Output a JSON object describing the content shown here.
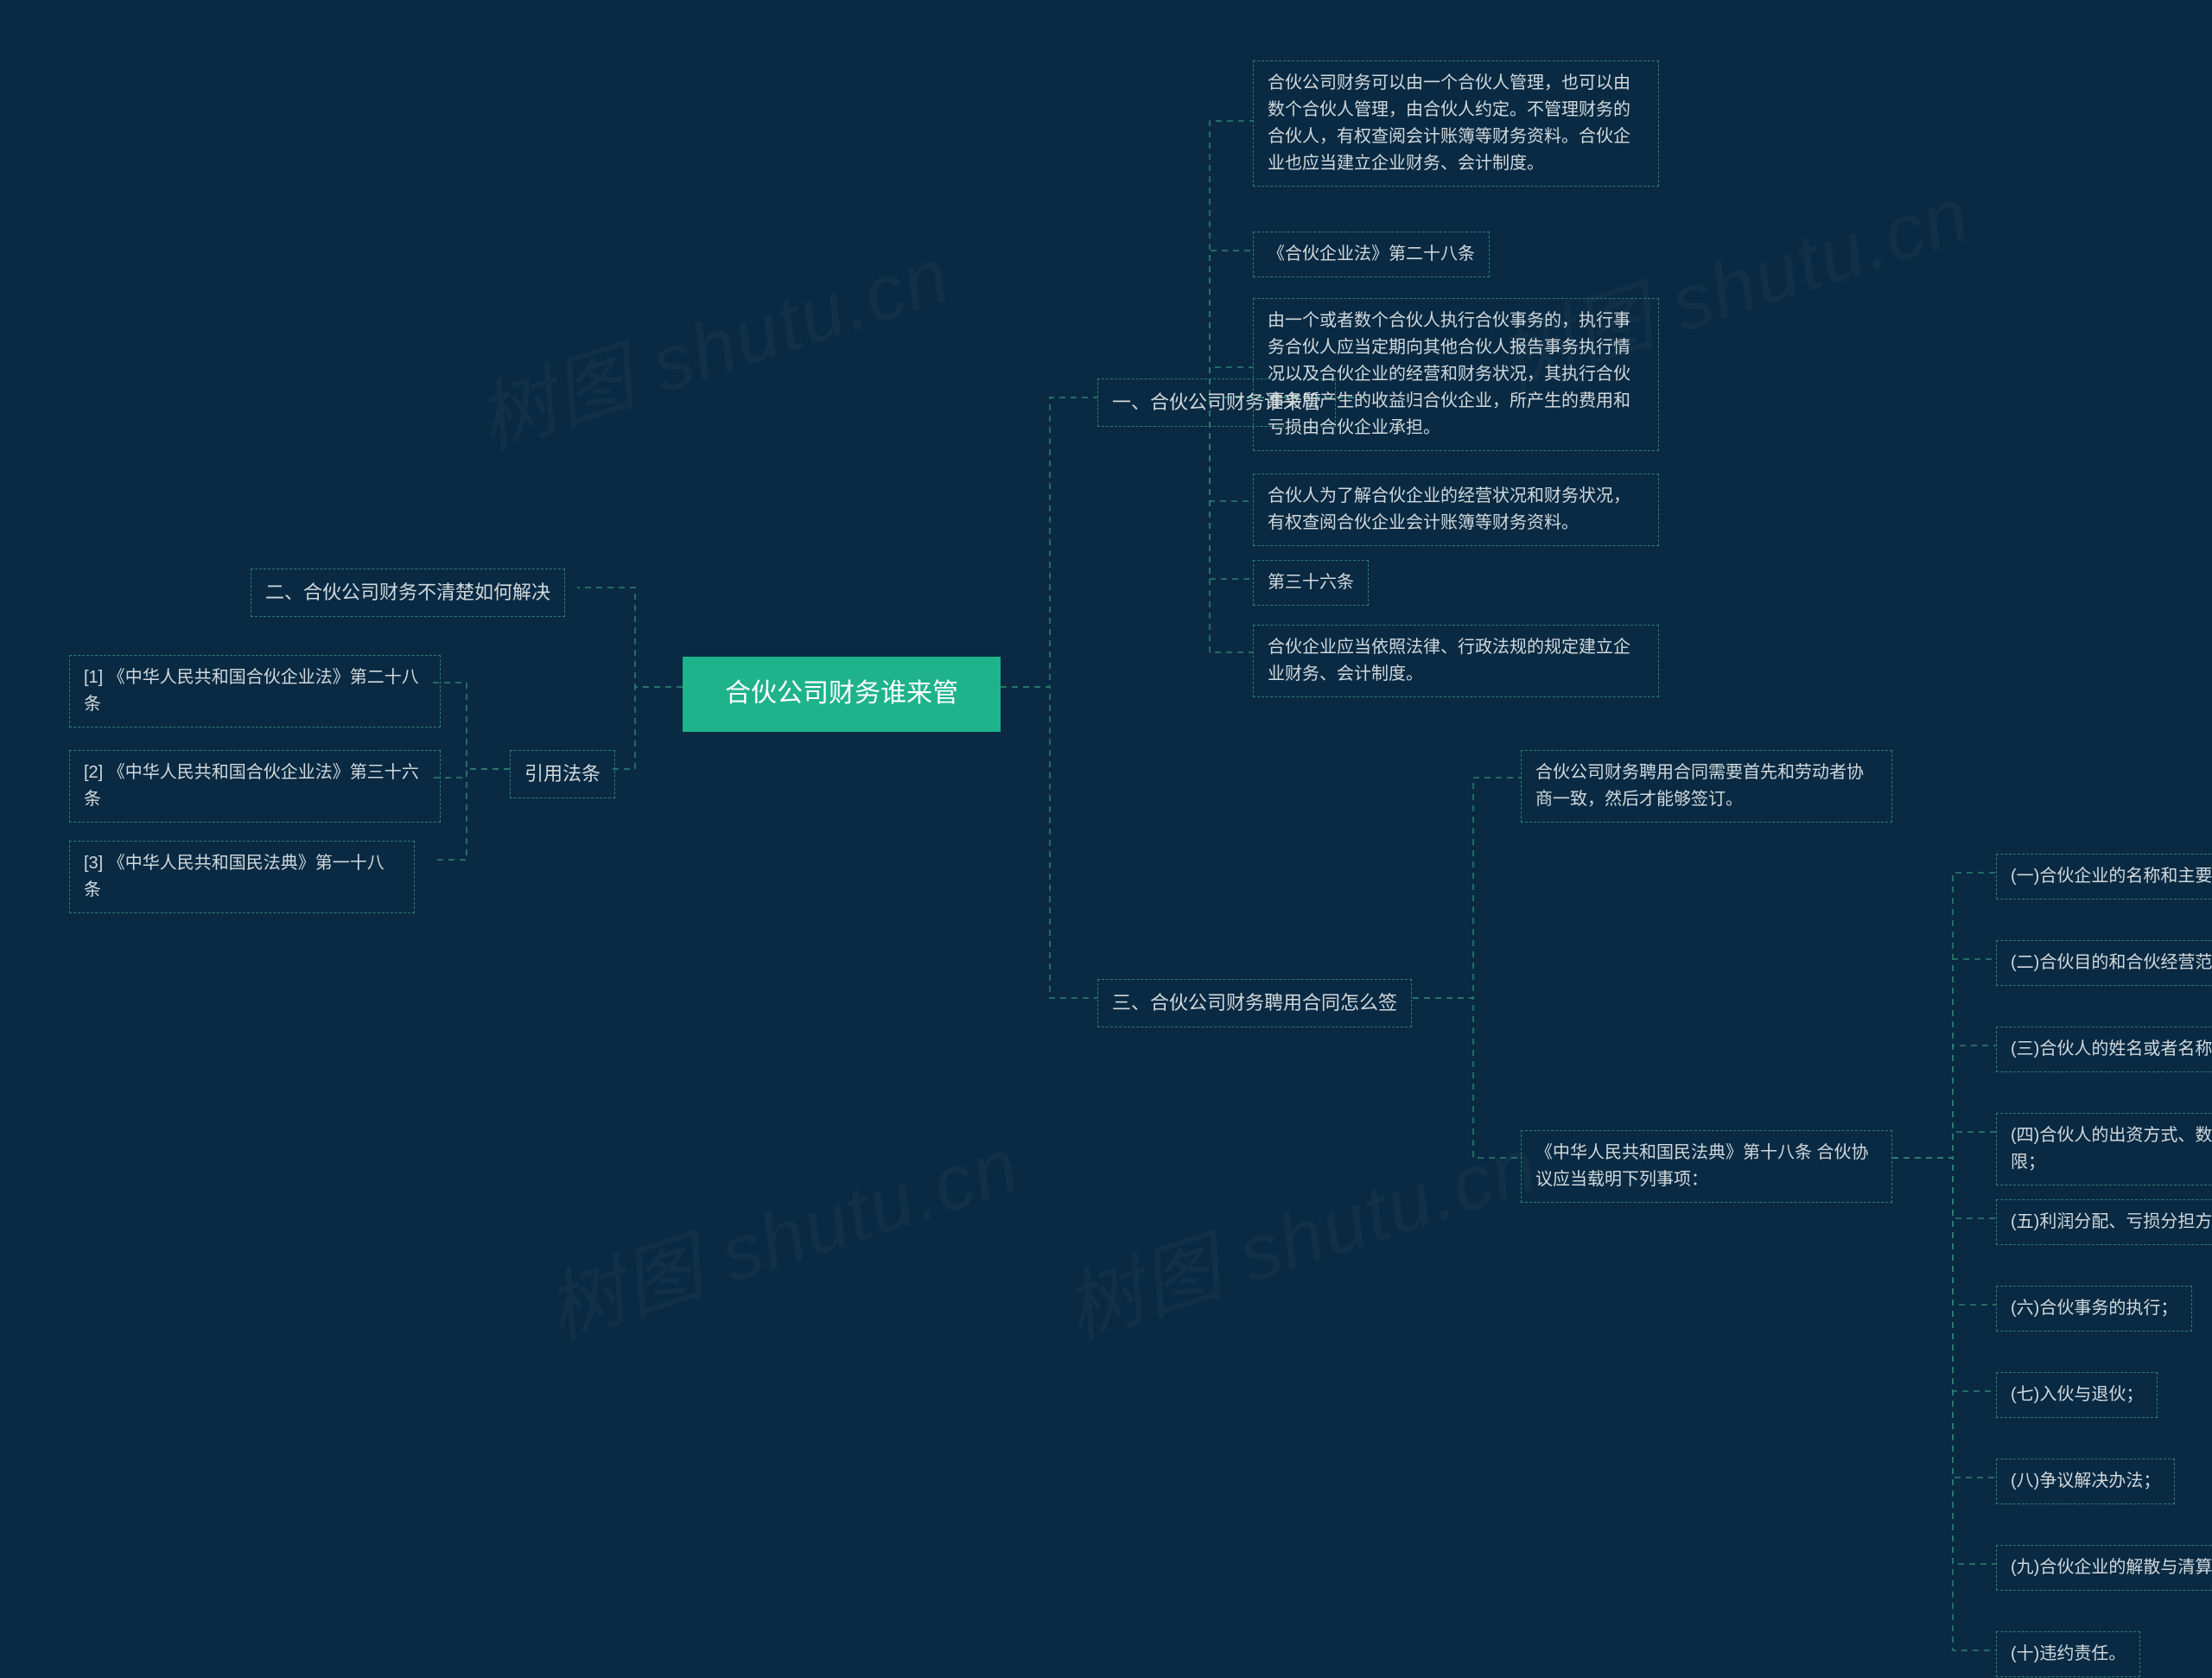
{
  "chart_data": {
    "type": "mindmap",
    "root": "合伙公司财务谁来管",
    "branches": [
      {
        "side": "right",
        "label": "一、合伙公司财务谁来管",
        "children": [
          {
            "label": "合伙公司财务可以由一个合伙人管理，也可以由数个合伙人管理，由合伙人约定。不管理财务的合伙人，有权查阅会计账簿等财务资料。合伙企业也应当建立企业财务、会计制度。"
          },
          {
            "label": "《合伙企业法》第二十八条"
          },
          {
            "label": "由一个或者数个合伙人执行合伙事务的，执行事务合伙人应当定期向其他合伙人报告事务执行情况以及合伙企业的经营和财务状况，其执行合伙事务所产生的收益归合伙企业，所产生的费用和亏损由合伙企业承担。"
          },
          {
            "label": "合伙人为了解合伙企业的经营状况和财务状况，有权查阅合伙企业会计账簿等财务资料。"
          },
          {
            "label": "第三十六条"
          },
          {
            "label": "合伙企业应当依照法律、行政法规的规定建立企业财务、会计制度。"
          }
        ]
      },
      {
        "side": "right",
        "label": "三、合伙公司财务聘用合同怎么签",
        "children": [
          {
            "label": "合伙公司财务聘用合同需要首先和劳动者协商一致，然后才能够签订。"
          },
          {
            "label": "《中华人民共和国民法典》第十八条 合伙协议应当载明下列事项：",
            "children": [
              {
                "label": "(一)合伙企业的名称和主要经营场所的地点；"
              },
              {
                "label": "(二)合伙目的和合伙经营范围；"
              },
              {
                "label": "(三)合伙人的姓名或者名称、住所；"
              },
              {
                "label": "(四)合伙人的出资方式、数额和缴付期限；"
              },
              {
                "label": "(五)利润分配、亏损分担方式；"
              },
              {
                "label": "(六)合伙事务的执行；"
              },
              {
                "label": "(七)入伙与退伙；"
              },
              {
                "label": "(八)争议解决办法；"
              },
              {
                "label": "(九)合伙企业的解散与清算；"
              },
              {
                "label": "(十)违约责任。"
              }
            ]
          }
        ]
      },
      {
        "side": "left",
        "label": "二、合伙公司财务不清楚如何解决"
      },
      {
        "side": "left",
        "label": "引用法条",
        "children": [
          {
            "label": "[1] 《中华人民共和国合伙企业法》第二十八条"
          },
          {
            "label": "[2] 《中华人民共和国合伙企业法》第三十六条"
          },
          {
            "label": "[3] 《中华人民共和国民法典》第一十八条"
          }
        ]
      }
    ]
  },
  "root": {
    "label": "合伙公司财务谁来管"
  },
  "watermark": "树图 shutu.cn",
  "right1": {
    "label": "一、合伙公司财务谁来管",
    "c1": "合伙公司财务可以由一个合伙人管理，也可以由数个合伙人管理，由合伙人约定。不管理财务的合伙人，有权查阅会计账簿等财务资料。合伙企业也应当建立企业财务、会计制度。",
    "c2": "《合伙企业法》第二十八条",
    "c3": "由一个或者数个合伙人执行合伙事务的，执行事务合伙人应当定期向其他合伙人报告事务执行情况以及合伙企业的经营和财务状况，其执行合伙事务所产生的收益归合伙企业，所产生生的费用和亏损由合伙企业承担。",
    "c3fix": "由一个或者数个合伙人执行合伙事务的，执行事务合伙人应当定期向其他合伙人报告事务执行情况以及合伙企业的经营和财务状况，其执行合伙事务所产生的收益归合伙企业，所产生的费用和亏损由合伙企业承担。",
    "c4": "合伙人为了解合伙企业的经营状况和财务状况，有权查阅合伙企业会计账簿等财务资料。",
    "c5": "第三十六条",
    "c6": "合伙企业应当依照法律、行政法规的规定建立企业财务、会计制度。"
  },
  "right2": {
    "label": "三、合伙公司财务聘用合同怎么签",
    "c1": "合伙公司财务聘用合同需要首先和劳动者协商一致，然后才能够签订。",
    "c2": "《中华人民共和国民法典》第十八条 合伙协议应当载明下列事项：",
    "gc": {
      "g1": "(一)合伙企业的名称和主要经营场所的地点；",
      "g2": "(二)合伙目的和合伙经营范围；",
      "g3": "(三)合伙人的姓名或者名称、住所；",
      "g4": "(四)合伙人的出资方式、数额和缴付期限；",
      "g5": "(五)利润分配、亏损分担方式；",
      "g6": "(六)合伙事务的执行；",
      "g7": "(七)入伙与退伙；",
      "g8": "(八)争议解决办法；",
      "g9": "(九)合伙企业的解散与清算；",
      "g10": "(十)违约责任。"
    }
  },
  "left1": {
    "label": "二、合伙公司财务不清楚如何解决"
  },
  "left2": {
    "label": "引用法条",
    "c1": "[1] 《中华人民共和国合伙企业法》第二十八条",
    "c2": "[2] 《中华人民共和国合伙企业法》第三十六条",
    "c3": "[3] 《中华人民共和国民法典》第一十八条"
  }
}
